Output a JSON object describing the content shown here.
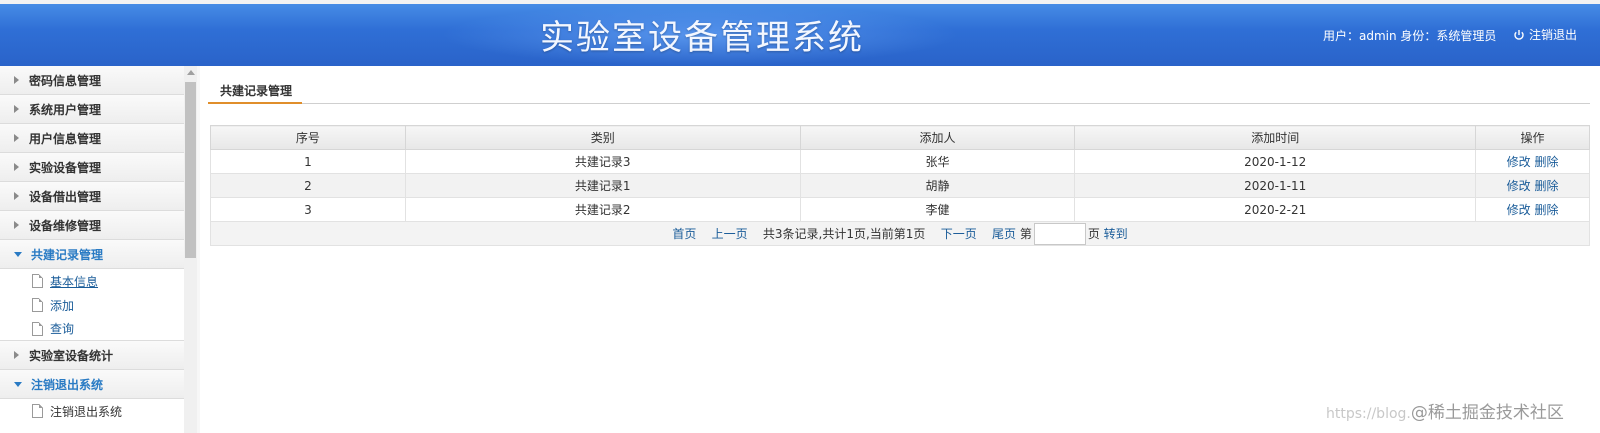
{
  "header": {
    "title": "实验室设备管理系统",
    "user_info": "用户：admin 身份：系统管理员",
    "logout_label": "注销退出"
  },
  "sidebar": {
    "items": [
      {
        "label": "密码信息管理",
        "expanded": false
      },
      {
        "label": "系统用户管理",
        "expanded": false
      },
      {
        "label": "用户信息管理",
        "expanded": false
      },
      {
        "label": "实验设备管理",
        "expanded": false
      },
      {
        "label": "设备借出管理",
        "expanded": false
      },
      {
        "label": "设备维修管理",
        "expanded": false
      },
      {
        "label": "共建记录管理",
        "expanded": true
      },
      {
        "label": "实验室设备统计",
        "expanded": false
      },
      {
        "label": "注销退出系统",
        "expanded": true
      }
    ],
    "coop_sub": [
      "基本信息",
      "添加",
      "查询"
    ],
    "logout_sub": [
      "注销退出系统"
    ]
  },
  "main": {
    "tab": "共建记录管理",
    "table": {
      "headers": [
        "序号",
        "类别",
        "添加人",
        "添加时间",
        "操作"
      ],
      "rows": [
        {
          "no": "1",
          "category": "共建记录3",
          "adder": "张华",
          "time": "2020-1-12"
        },
        {
          "no": "2",
          "category": "共建记录1",
          "adder": "胡静",
          "time": "2020-1-11"
        },
        {
          "no": "3",
          "category": "共建记录2",
          "adder": "李健",
          "time": "2020-2-21"
        }
      ],
      "edit_label": "修改",
      "delete_label": "删除"
    },
    "pager": {
      "first": "首页",
      "prev": "上一页",
      "summary": "共3条记录,共计1页,当前第1页",
      "next": "下一页",
      "last": "尾页",
      "page_prefix": "第",
      "page_suffix": "页",
      "goto": "转到",
      "page_input": ""
    }
  },
  "watermark": {
    "url": "https://blog.",
    "brand": "@稀土掘金技术社区"
  },
  "colors": {
    "header_blue": "#2f6fd6",
    "link_blue": "#1a5c99",
    "active_blue": "#2a7bc4",
    "tab_underline": "#e08e2b"
  }
}
